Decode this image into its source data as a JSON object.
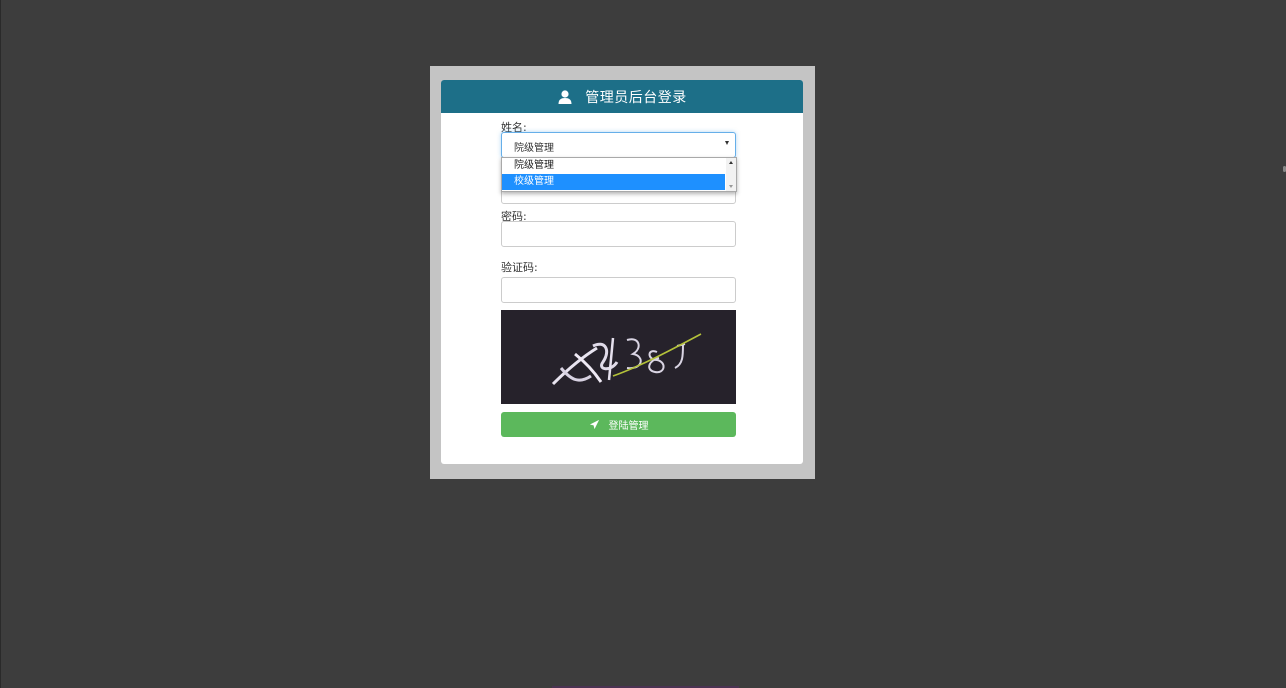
{
  "login": {
    "title": "管理员后台登录",
    "name_label": "姓名:",
    "name_select": {
      "value": "院级管理",
      "options": [
        "院级管理",
        "校级管理"
      ],
      "highlighted": "校级管理"
    },
    "password_label": "密码:",
    "password_value": "",
    "captcha_label": "验证码:",
    "captcha_value": "",
    "submit_label": "登陆管理"
  },
  "icons": {
    "header": "user-icon",
    "submit": "send-icon",
    "select": "chevron-down-icon"
  },
  "colors": {
    "background": "#3d3d3d",
    "header": "#1d6f88",
    "submit": "#5cb85c",
    "highlight": "#1e90ff"
  }
}
